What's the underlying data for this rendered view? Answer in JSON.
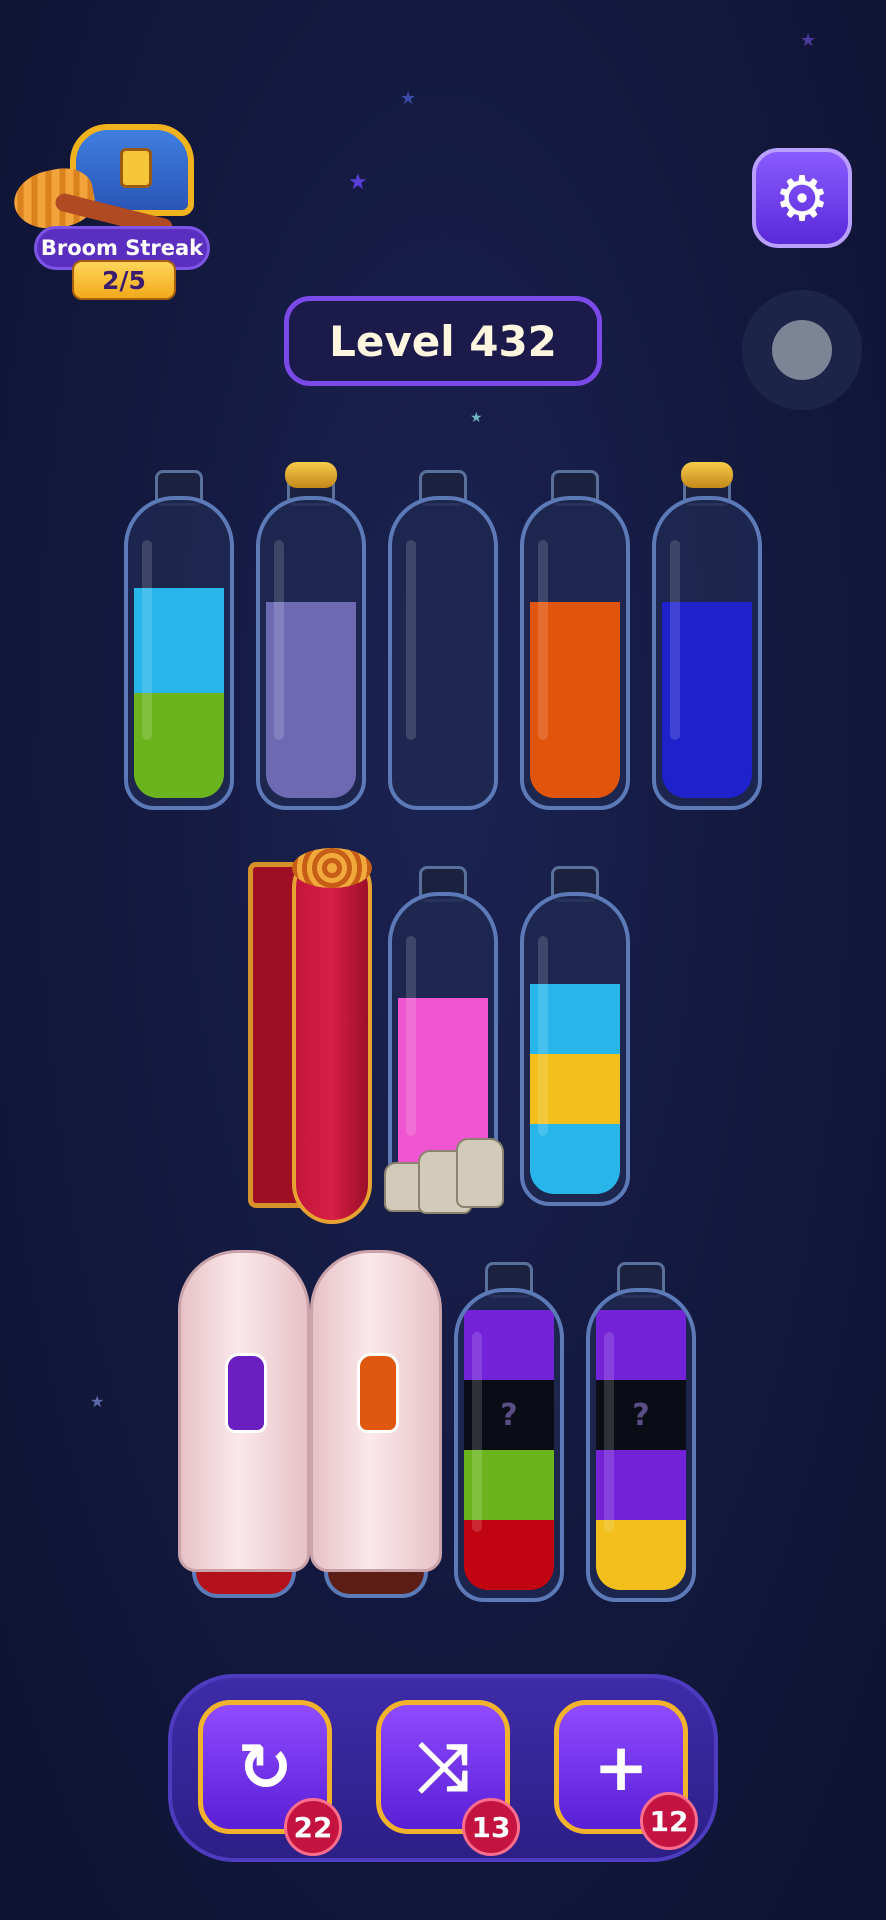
{
  "streak": {
    "label": "Broom Streak",
    "count": "2/5"
  },
  "level": {
    "label": "Level 432"
  },
  "settings": {
    "icon": "gear-icon"
  },
  "colors": {
    "cyan": "#28b6ea",
    "green": "#6cb41e",
    "lavender": "#6d6ab3",
    "orange": "#e0540b",
    "blue": "#1f21cc",
    "pink": "#ef55d0",
    "yellow": "#f2bf1c",
    "purple": "#7322d8",
    "red": "#c10411",
    "black": "#0b0d16"
  },
  "bottles": [
    {
      "segments": [
        "cyan",
        "green"
      ],
      "cork": false
    },
    {
      "segments": [
        "lavender"
      ],
      "cork": true
    },
    {
      "segments": [],
      "cork": false
    },
    {
      "segments": [
        "orange"
      ],
      "cork": false
    },
    {
      "segments": [
        "blue"
      ],
      "cork": true
    },
    {
      "segments": [
        "pink"
      ],
      "cork": false
    },
    {
      "segments": [
        "cyan",
        "yellow",
        "cyan"
      ],
      "cork": false
    },
    {
      "segments": [
        "purple",
        "hidden",
        "green",
        "red"
      ],
      "cork": false
    },
    {
      "segments": [
        "purple",
        "hidden",
        "purple",
        "yellow"
      ],
      "cork": false
    }
  ],
  "hidden_mark": "?",
  "tools": [
    {
      "name": "undo",
      "icon": "undo-icon",
      "glyph": "↻",
      "count": "22"
    },
    {
      "name": "shuffle",
      "icon": "shuffle-icon",
      "glyph": "⤨",
      "count": "13"
    },
    {
      "name": "add-bottle",
      "icon": "add-bottle-icon",
      "glyph": "+",
      "count": "12"
    }
  ]
}
